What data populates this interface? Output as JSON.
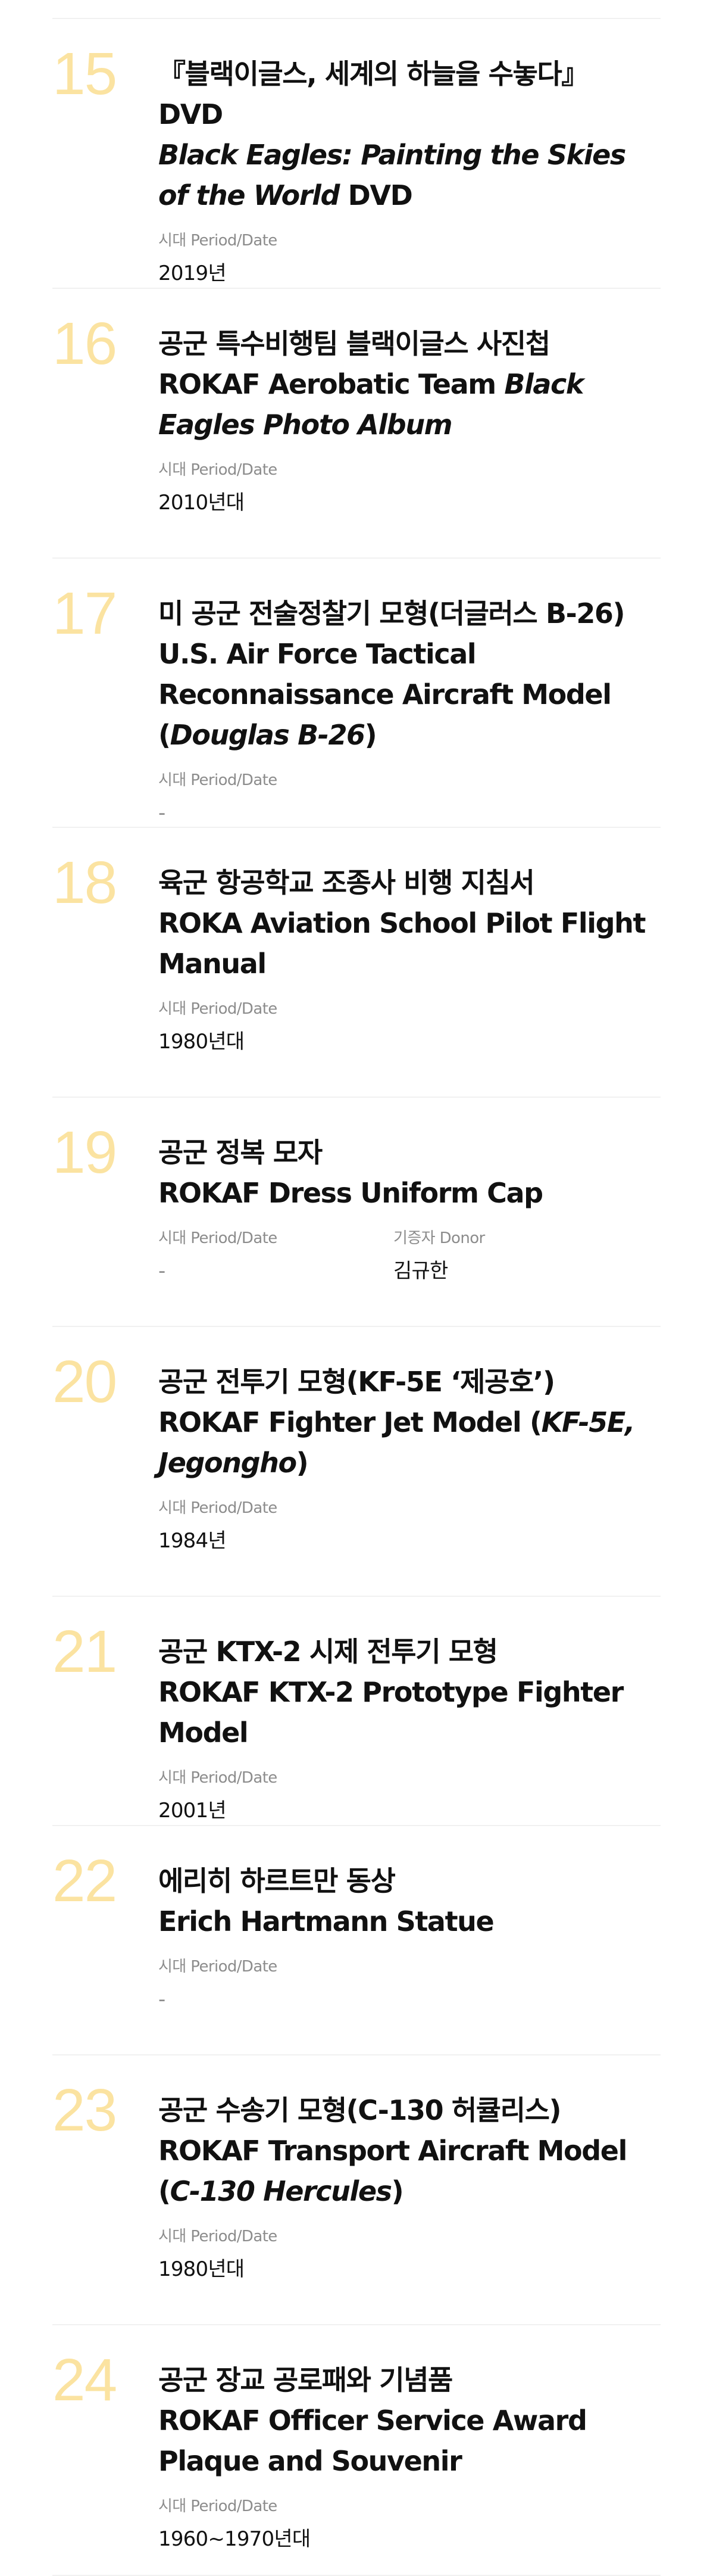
{
  "items": [
    {
      "number": "15",
      "title_ko": "『블랙이글스, 세계의 하늘을 수놓다』 DVD",
      "title_en_parts": [
        {
          "text": "Black Eagles: Painting the Skies of the World",
          "italic": true
        },
        {
          "text": " DVD",
          "italic": false
        }
      ],
      "meta": [
        {
          "label": "시대 Period/Date",
          "value": "2019년"
        }
      ]
    },
    {
      "number": "16",
      "title_ko": "공군 특수비행팀 블랙이글스 사진첩",
      "title_en_parts": [
        {
          "text": "ROKAF Aerobatic Team ",
          "italic": false
        },
        {
          "text": "Black Eagles",
          "italic": true
        },
        {
          "text": " ",
          "italic": false
        },
        {
          "text": "Photo Album",
          "italic": true
        }
      ],
      "meta": [
        {
          "label": "시대 Period/Date",
          "value": "2010년대"
        }
      ]
    },
    {
      "number": "17",
      "title_ko": "미 공군 전술정찰기 모형(더글러스 B-26)",
      "title_en_parts": [
        {
          "text": "U.S. Air Force Tactical Reconnaissance Aircraft Model (",
          "italic": false
        },
        {
          "text": "Douglas B-26",
          "italic": true
        },
        {
          "text": ")",
          "italic": false
        }
      ],
      "meta": [
        {
          "label": "시대 Period/Date",
          "value": "-"
        }
      ]
    },
    {
      "number": "18",
      "title_ko": "육군 항공학교 조종사 비행 지침서",
      "title_en_parts": [
        {
          "text": "ROKA Aviation School Pilot Flight Manual",
          "italic": false
        }
      ],
      "meta": [
        {
          "label": "시대 Period/Date",
          "value": "1980년대"
        }
      ]
    },
    {
      "number": "19",
      "title_ko": "공군 정복 모자",
      "title_en_parts": [
        {
          "text": "ROKAF Dress Uniform Cap",
          "italic": false
        }
      ],
      "meta": [
        {
          "label": "시대 Period/Date",
          "value": "-"
        },
        {
          "label": "기증자 Donor",
          "value": "김규한"
        }
      ]
    },
    {
      "number": "20",
      "title_ko": "공군 전투기 모형(KF-5E ‘제공호’)",
      "title_en_parts": [
        {
          "text": "ROKAF Fighter Jet Model (",
          "italic": false
        },
        {
          "text": "KF-5E, Jegongho",
          "italic": true
        },
        {
          "text": ")",
          "italic": false
        }
      ],
      "meta": [
        {
          "label": "시대 Period/Date",
          "value": "1984년"
        }
      ]
    },
    {
      "number": "21",
      "title_ko": "공군 KTX-2 시제 전투기 모형",
      "title_en_parts": [
        {
          "text": "ROKAF KTX-2 Prototype Fighter Model",
          "italic": false
        }
      ],
      "meta": [
        {
          "label": "시대 Period/Date",
          "value": "2001년"
        }
      ]
    },
    {
      "number": "22",
      "title_ko": "에리히 하르트만 동상",
      "title_en_parts": [
        {
          "text": "Erich Hartmann Statue",
          "italic": false
        }
      ],
      "meta": [
        {
          "label": "시대 Period/Date",
          "value": "-"
        }
      ]
    },
    {
      "number": "23",
      "title_ko": "공군 수송기 모형(C-130 허큘리스)",
      "title_en_parts": [
        {
          "text": "ROKAF Transport Aircraft Model (",
          "italic": false
        },
        {
          "text": "C-130 Hercules",
          "italic": true
        },
        {
          "text": ")",
          "italic": false
        }
      ],
      "meta": [
        {
          "label": "시대 Period/Date",
          "value": "1980년대"
        }
      ]
    },
    {
      "number": "24",
      "title_ko": "공군 장교 공로패와 기념품",
      "title_en_parts": [
        {
          "text": "ROKAF Officer Service Award Plaque and Souvenir",
          "italic": false
        }
      ],
      "meta": [
        {
          "label": "시대 Period/Date",
          "value": "1960~1970년대"
        }
      ]
    }
  ]
}
